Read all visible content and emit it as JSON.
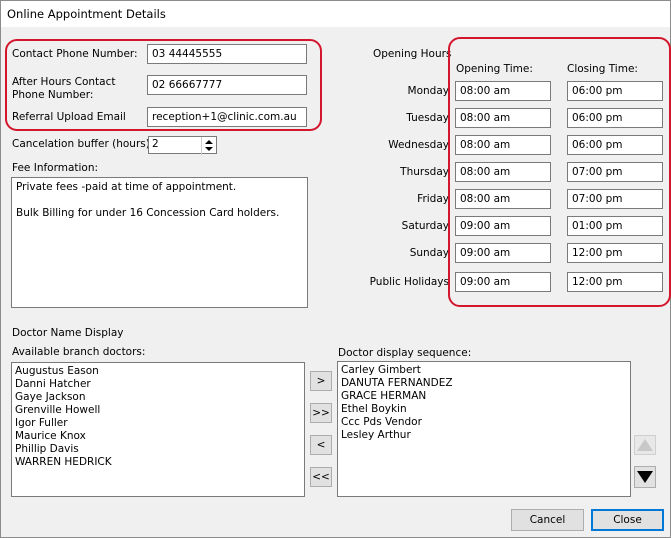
{
  "window": {
    "title": "Online Appointment Details"
  },
  "contact": {
    "phone_label": "Contact Phone Number:",
    "phone_value": "03 44445555",
    "after_hours_label_line1": "After Hours Contact",
    "after_hours_label_line2": "Phone Number:",
    "after_hours_value": "02 66667777",
    "referral_label": "Referral Upload Email",
    "referral_value": "reception+1@clinic.com.au"
  },
  "buffer": {
    "label": "Cancelation buffer (hours)",
    "value": "2"
  },
  "fee": {
    "label": "Fee Information:",
    "line1": "Private fees -paid at time of appointment.",
    "line2": "Bulk Billing for under 16 Concession Card holders."
  },
  "hours": {
    "section_label": "Opening Hours",
    "opening_header": "Opening Time:",
    "closing_header": "Closing Time:",
    "days": [
      {
        "day": "Monday",
        "open": "08:00 am",
        "close": "06:00 pm"
      },
      {
        "day": "Tuesday",
        "open": "08:00 am",
        "close": "06:00 pm"
      },
      {
        "day": "Wednesday",
        "open": "08:00 am",
        "close": "06:00 pm"
      },
      {
        "day": "Thursday",
        "open": "08:00 am",
        "close": "07:00 pm"
      },
      {
        "day": "Friday",
        "open": "08:00 am",
        "close": "07:00 pm"
      },
      {
        "day": "Saturday",
        "open": "09:00 am",
        "close": "01:00 pm"
      },
      {
        "day": "Sunday",
        "open": "09:00 am",
        "close": "12:00 pm"
      },
      {
        "day": "Public Holidays",
        "open": "09:00 am",
        "close": "12:00 pm"
      }
    ]
  },
  "doctors": {
    "section_label": "Doctor Name Display",
    "available_label": "Available branch doctors:",
    "available": [
      "Augustus Eason",
      "Danni Hatcher",
      "Gaye Jackson",
      "Grenville Howell",
      "Igor Fuller",
      "Maurice Knox",
      "Phillip Davis",
      "WARREN HEDRICK"
    ],
    "sequence_label": "Doctor display sequence:",
    "sequence": [
      "Carley Gimbert",
      "DANUTA FERNANDEZ",
      "GRACE HERMAN",
      "Ethel Boykin",
      "Ccc Pds Vendor",
      "Lesley Arthur"
    ],
    "move_right": ">",
    "move_all_right": ">>",
    "move_left": "<",
    "move_all_left": "<<"
  },
  "footer": {
    "cancel": "Cancel",
    "close": "Close"
  },
  "colors": {
    "highlight": "#d3162d",
    "primary_border": "#0078d7"
  }
}
